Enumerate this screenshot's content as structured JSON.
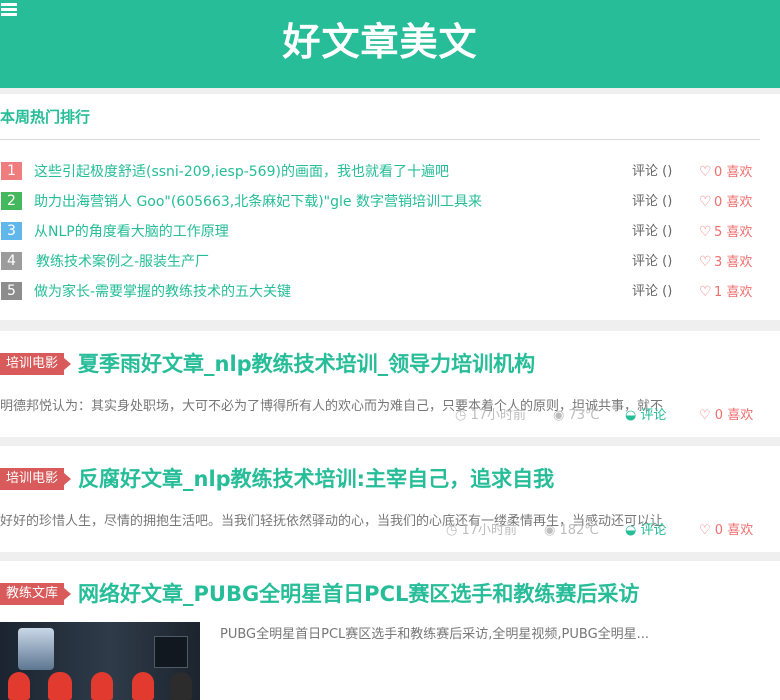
{
  "header": {
    "title": "好文章美文",
    "menu_icon": "list-icon",
    "background_color": "#26bd98"
  },
  "weekly_ranking": {
    "title": "本周热门排行",
    "items": [
      {
        "rank": "1",
        "title": "这些引起极度舒适(ssni-209,iesp-569)的画面，我也就看了十遍吧",
        "comments": "评论 ()",
        "likes": "0 喜欢",
        "rank_color": "#ef7d7d"
      },
      {
        "rank": "2",
        "title": "助力出海营销人 Goo\"(605663,北条麻妃下载)\"gle 数字营销培训工具来",
        "comments": "评论 ()",
        "likes": "0 喜欢",
        "rank_color": "#45b85e"
      },
      {
        "rank": "3",
        "title": "从NLP的角度看大脑的工作原理",
        "comments": "评论 ()",
        "likes": "5 喜欢",
        "rank_color": "#61b7ea"
      },
      {
        "rank": "4",
        "title": "教练技术案例之-服装生产厂",
        "comments": "评论 ()",
        "likes": "3 喜欢",
        "rank_color": "#9c9c9c"
      },
      {
        "rank": "5",
        "title": "做为家长-需要掌握的教练技术的五大关键",
        "comments": "评论 ()",
        "likes": "1 喜欢",
        "rank_color": "#8d8d8d"
      }
    ]
  },
  "articles": [
    {
      "tag": "培训电影",
      "tag_color": "#d85a5a",
      "title": "夏季雨好文章_nlp教练技术培训_领导力培训机构",
      "excerpt": "明德邦悦认为：其实身处职场，大可不必为了博得所有人的欢心而为难自己，只要本着个人的原则，坦诚共事，就不",
      "time": "17小时前",
      "views": "73℃",
      "comments_label": "评论",
      "likes": "0 喜欢"
    },
    {
      "tag": "培训电影",
      "tag_color": "#d85a5a",
      "title": "反腐好文章_nlp教练技术培训:主宰自己，追求自我",
      "excerpt": "好好的珍惜人生，尽情的拥抱生活吧。当我们轻抚依然驿动的心，当我们的心底还有一缕柔情再生，当感动还可以让",
      "time": "17小时前",
      "views": "182℃",
      "comments_label": "评论",
      "likes": "0 喜欢"
    },
    {
      "tag": "教练文库",
      "tag_color": "#d85a5a",
      "title": "网络好文章_PUBG全明星首日PCL赛区选手和教练赛后采访",
      "summary": "PUBG全明星首日PCL赛区选手和教练赛后采访,全明星视频,PUBG全明星..."
    }
  ]
}
